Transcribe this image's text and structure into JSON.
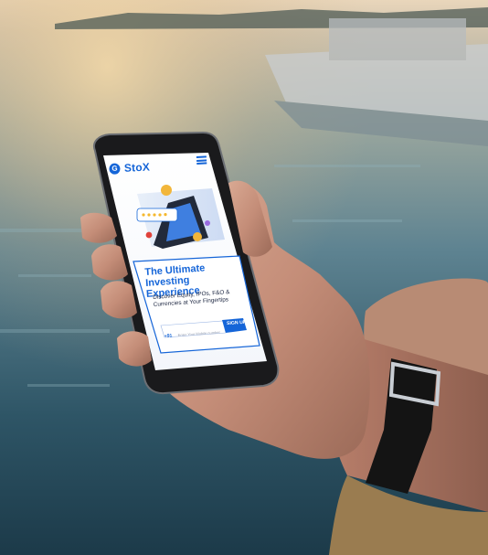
{
  "app": {
    "brand_letter": "G",
    "brand_name": "StoX",
    "menu_icon": "hamburger-icon"
  },
  "hero": {
    "headline_line1": "The Ultimate",
    "headline_line2": "Investing Experience",
    "description_line1": "Discover Equity, IPOs, F&O &",
    "description_line2": "Currencies at Your Fingertips",
    "illustration": "phone-with-coins-and-star-rating"
  },
  "signup": {
    "country_code": "+91",
    "placeholder": "Enter Your Mobile number",
    "button_label": "SIGN UP"
  },
  "colors": {
    "brand_blue": "#1565d8",
    "watch_strap": "#141414",
    "water": "#3d6a7c"
  }
}
